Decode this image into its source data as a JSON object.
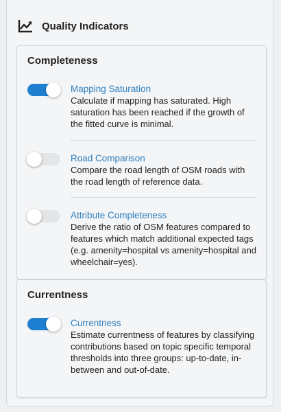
{
  "header": {
    "title": "Quality Indicators",
    "icon": "line-chart-icon"
  },
  "cards": {
    "completeness": {
      "title": "Completeness",
      "indicators": [
        {
          "label": "Mapping Saturation",
          "enabled": true,
          "description": "Calculate if mapping has saturated. High saturation has been reached if the growth of the fitted curve is minimal."
        },
        {
          "label": "Road Comparison",
          "enabled": false,
          "description": "Compare the road length of OSM roads with the road length of reference data."
        },
        {
          "label": "Attribute Completeness",
          "enabled": false,
          "description": "Derive the ratio of OSM features compared to features which match additional expected tags (e.g. amenity=hospital vs amenity=hospital and wheelchair=yes)."
        }
      ]
    },
    "currentness": {
      "title": "Currentness",
      "indicators": [
        {
          "label": "Currentness",
          "enabled": true,
          "description": "Estimate currentness of features by classifying contributions based on topic specific temporal thresholds into three groups: up-to-date, in-between and out-of-date."
        }
      ]
    }
  },
  "colors": {
    "toggle_on": "#1f7fd1",
    "toggle_off": "#e3e5e7",
    "label_link": "#2f7fbf"
  }
}
